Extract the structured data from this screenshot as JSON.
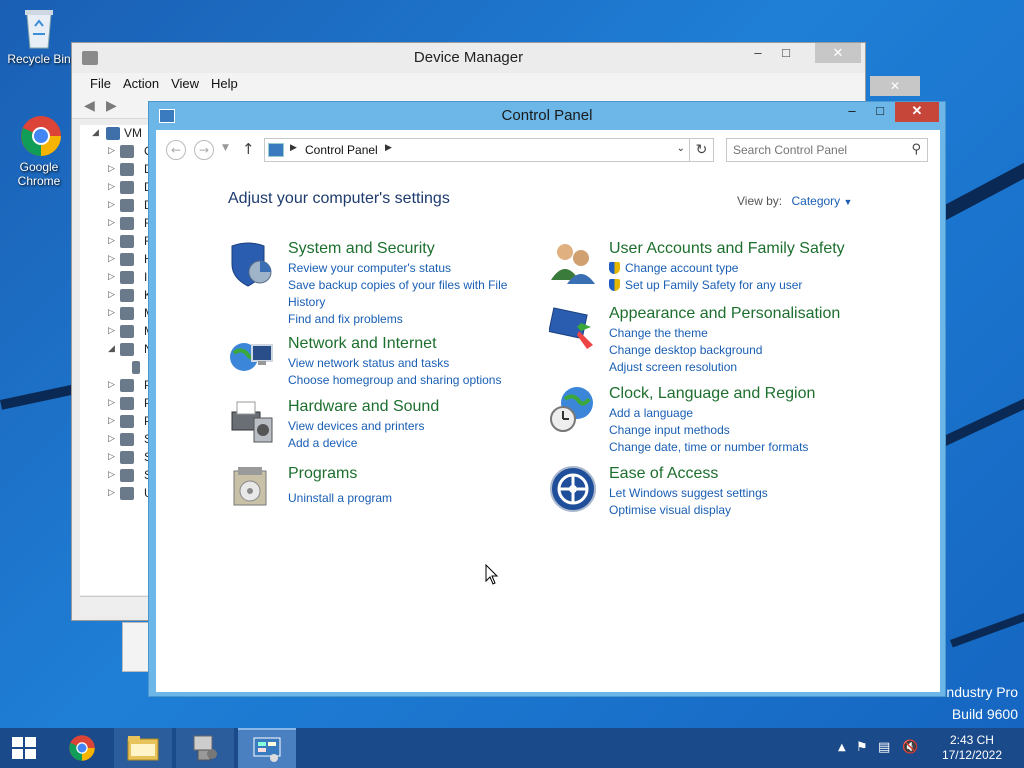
{
  "desktop": {
    "icons": [
      {
        "label": "Recycle Bin"
      },
      {
        "label": "Google Chrome"
      }
    ],
    "watermark": {
      "line1": "ndustry Pro",
      "line2": "Build 9600"
    }
  },
  "device_manager": {
    "title": "Device Manager",
    "menu": [
      "File",
      "Action",
      "View",
      "Help"
    ],
    "tree_root": "VM",
    "tree_items": [
      "C",
      "D",
      "D",
      "D",
      "F",
      "F",
      "H",
      "II",
      "K",
      "M",
      "M",
      "N",
      "",
      "P",
      "P",
      "P",
      "S",
      "S",
      "S",
      "U"
    ]
  },
  "control_panel": {
    "title": "Control Panel",
    "address": "Control Panel",
    "search_placeholder": "Search Control Panel",
    "heading": "Adjust your computer's settings",
    "view_by_label": "View by:",
    "view_by_value": "Category",
    "categories": [
      {
        "title": "System and Security",
        "links": [
          "Review your computer's status",
          "Save backup copies of your files with File",
          "History",
          "Find and fix problems"
        ]
      },
      {
        "title": "Network and Internet",
        "links": [
          "View network status and tasks",
          "Choose homegroup and sharing options"
        ]
      },
      {
        "title": "Hardware and Sound",
        "links": [
          "View devices and printers",
          "Add a device"
        ]
      },
      {
        "title": "Programs",
        "links": [
          "Uninstall a program"
        ]
      },
      {
        "title": "User Accounts and Family Safety",
        "links": [
          "Change account type",
          "Set up Family Safety for any user"
        ]
      },
      {
        "title": "Appearance and Personalisation",
        "links": [
          "Change the theme",
          "Change desktop background",
          "Adjust screen resolution"
        ]
      },
      {
        "title": "Clock, Language and Region",
        "links": [
          "Add a language",
          "Change input methods",
          "Change date, time or number formats"
        ]
      },
      {
        "title": "Ease of Access",
        "links": [
          "Let Windows suggest settings",
          "Optimise visual display"
        ]
      }
    ]
  },
  "taskbar": {
    "time": "2:43 CH",
    "date": "17/12/2022"
  },
  "colors": {
    "taskbar": "#1b4a8a",
    "link": "#1a5fb4",
    "category_title": "#1d6f2e",
    "window_frame": "#6cb7e8",
    "close": "#c7463a"
  }
}
